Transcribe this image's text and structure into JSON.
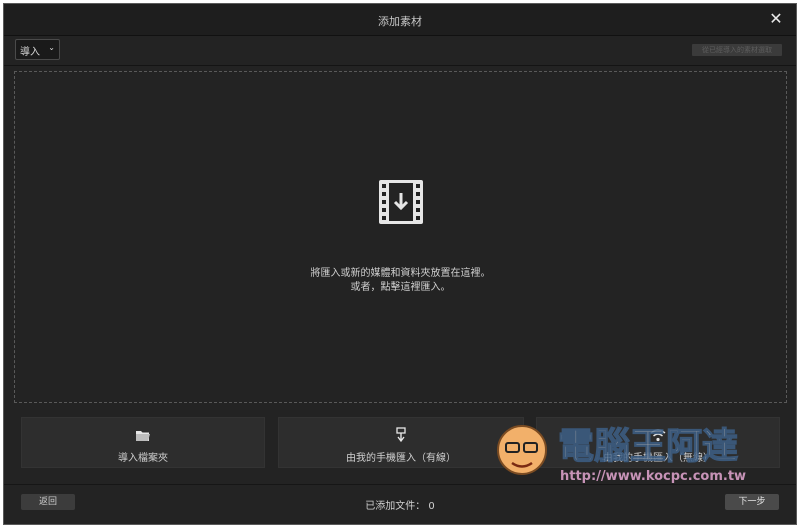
{
  "window": {
    "title": "添加素材",
    "close_icon": "close-icon"
  },
  "toolbar": {
    "import_dropdown": {
      "selected": "導入"
    },
    "disabled_button_label": "從已經導入的素材選取"
  },
  "drop_zone": {
    "icon": "film-download-icon",
    "line1": "將匯入或新的媒體和資料夾放置在這裡。",
    "line2": "或者，點擊這裡匯入。"
  },
  "sources": [
    {
      "label": "導入檔案夾",
      "icon": "folder-icon"
    },
    {
      "label": "由我的手機匯入（有線）",
      "icon": "usb-icon"
    },
    {
      "label": "由我的手機匯入（無線）",
      "icon": "wifi-icon"
    }
  ],
  "footer": {
    "back_label": "返回",
    "added_files_label": "已添加文件：",
    "added_files_count": "0",
    "next_label": "下一步"
  },
  "watermark": {
    "text": "電腦王阿達",
    "url": "http://www.kocpc.com.tw"
  },
  "colors": {
    "window_bg": "#232323",
    "titlebar_bg": "#1e1e1e",
    "button_bg": "#2d2d2d",
    "text": "#d0d0d0"
  }
}
